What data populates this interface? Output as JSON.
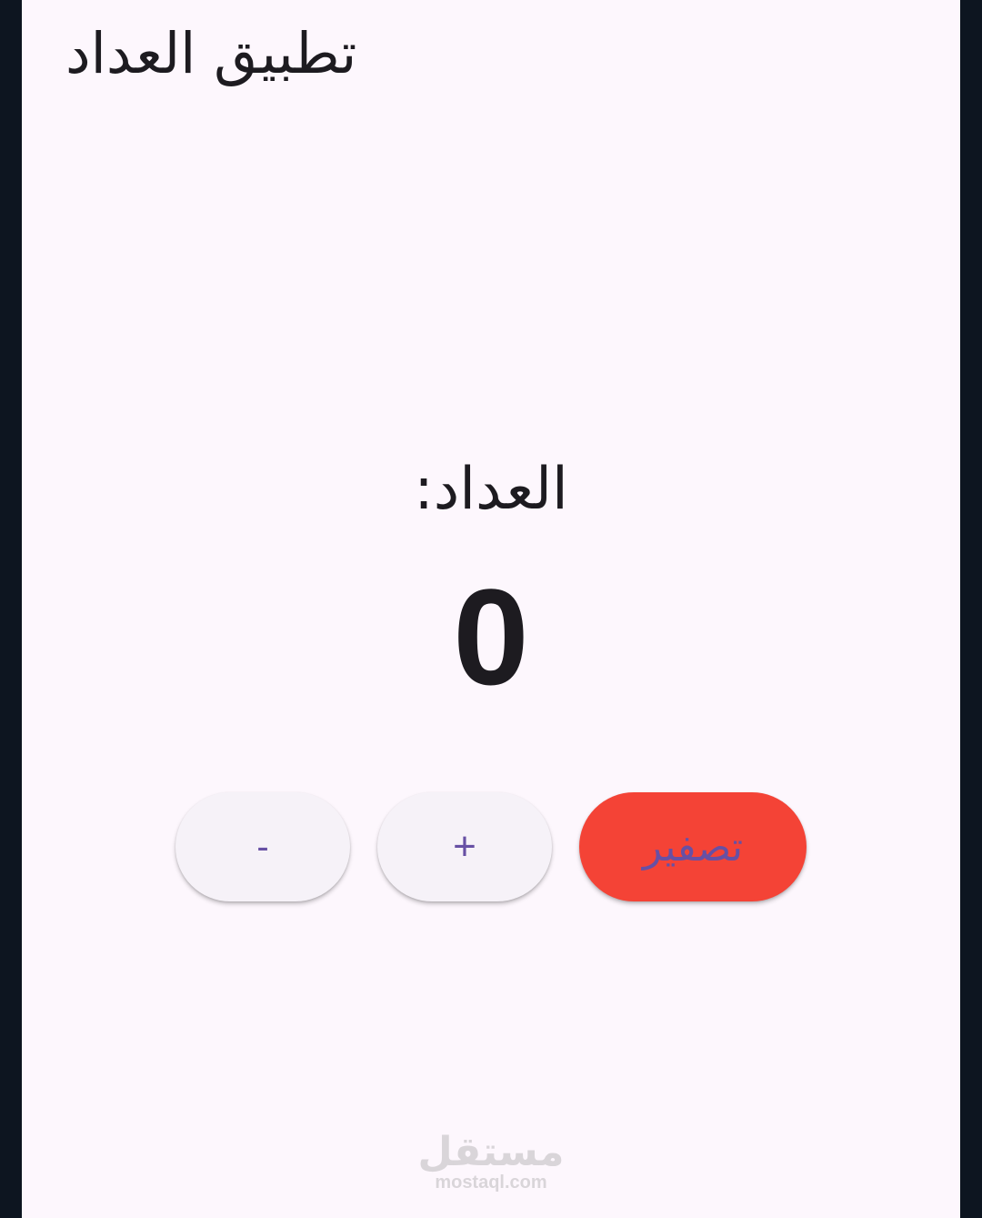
{
  "app": {
    "title": "تطبيق العداد"
  },
  "counter": {
    "label": "العداد:",
    "value": "0"
  },
  "buttons": {
    "decrement_label": "-",
    "increment_label": "+",
    "reset_label": "تصفير"
  },
  "watermark": {
    "arabic": "مستقل",
    "latin": "mostaql.com"
  },
  "colors": {
    "background": "#fdf7fd",
    "reset_button": "#f44336",
    "button_text": "#6750a4",
    "secondary_button": "#f6f2f8"
  }
}
